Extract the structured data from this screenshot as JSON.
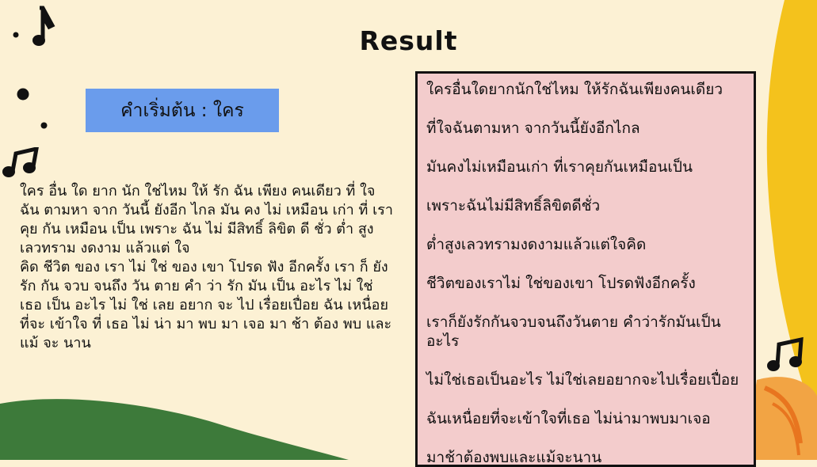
{
  "title": "Result",
  "start_label": "คำเริ่มต้น : ใคร",
  "tokenized_text": [
    "ใคร อื่น ใด ยาก นัก ใช่ไหม ให้ รัก ฉัน เพียง คนเดียว ที่ ใจ ฉัน ตามหา จาก วันนี้ ยังอีก ไกล มัน คง ไม่ เหมือน เก่า ที่ เรา คุย กัน เหมือน เป็น เพราะ ฉัน ไม่ มีสิทธิ์ ลิขิต ดี ชั่ว ต่ำ สูง เลวทราม งดงาม แล้วแต่ ใจ",
    " คิด ชีวิต ของ เรา ไม่ ใช่ ของ เขา โปรด ฟัง อีกครั้ง เรา ก็ ยัง รัก กัน จวบ จนถึง วัน ตาย คำ ว่า รัก มัน เป็น อะไร ไม่ ใช่ เธอ เป็น อะไร ไม่ ใช่ เลย อยาก จะ ไป เรื่อยเปื่อย ฉัน เหนื่อย ที่จะ เข้าใจ ที่ เธอ ไม่ น่า มา พบ มา เจอ มา ช้า ต้อง พบ และ แม้ จะ นาน"
  ],
  "result_lines": [
    "ใครอื่นใดยากนักใช่ไหม   ให้รักฉันเพียงคนเดียว",
    "ที่ใจฉันตามหา  จากวันนี้ยังอีกไกล",
    "มันคงไม่เหมือนเก่า ที่เราคุยกันเหมือนเป็น",
    "เพราะฉันไม่มีสิทธิ์ลิขิตดีชั่ว",
    "ต่ำสูงเลวทรามงดงามแล้วแต่ใจคิด",
    "ชีวิตของเราไม่ ใช่ของเขา  โปรดฟังอีกครั้ง",
    "เราก็ยังรักกันจวบจนถึงวันตาย คำว่ารักมันเป็นอะไร",
    "ไม่ใช่เธอเป็นอะไร ไม่ใช่เลยอยากจะไปเรื่อยเปื่อย",
    "ฉันเหนื่อยที่จะเข้าใจที่เธอ ไม่น่ามาพบมาเจอ",
    "มาช้าต้องพบและแม้จะนาน"
  ],
  "colors": {
    "background": "#fcf1d4",
    "start_box": "#6a9cec",
    "result_box": "#f3cccc",
    "hill": "#3d7a3a",
    "sun": "#f4c21c",
    "accent_orange": "#f2a444"
  },
  "icons": [
    "music-note-icon",
    "beamed-notes-icon"
  ]
}
